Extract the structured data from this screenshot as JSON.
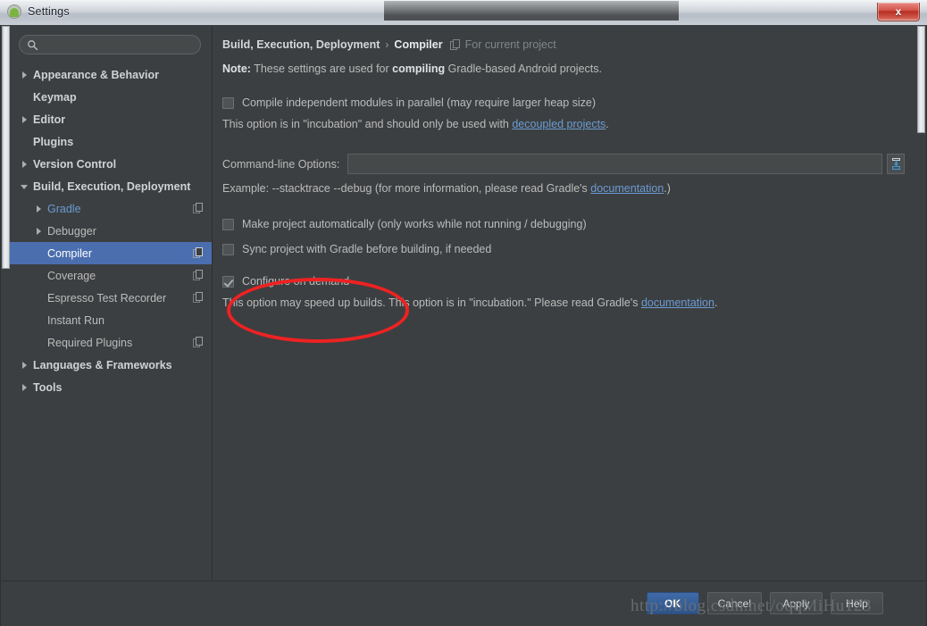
{
  "window": {
    "title": "Settings",
    "app_icon": "android-studio-icon",
    "close_label": "x"
  },
  "sidebar": {
    "search": {
      "placeholder": "",
      "value": "",
      "icon": "search-icon"
    },
    "items": [
      {
        "label": "Appearance & Behavior",
        "level": 0,
        "arrow": "right",
        "bold": true,
        "selected": false,
        "project_icon": false
      },
      {
        "label": "Keymap",
        "level": 0,
        "arrow": "none",
        "bold": true,
        "selected": false,
        "project_icon": false
      },
      {
        "label": "Editor",
        "level": 0,
        "arrow": "right",
        "bold": true,
        "selected": false,
        "project_icon": false
      },
      {
        "label": "Plugins",
        "level": 0,
        "arrow": "none",
        "bold": true,
        "selected": false,
        "project_icon": false
      },
      {
        "label": "Version Control",
        "level": 0,
        "arrow": "right",
        "bold": true,
        "selected": false,
        "project_icon": false
      },
      {
        "label": "Build, Execution, Deployment",
        "level": 0,
        "arrow": "down",
        "bold": true,
        "selected": false,
        "project_icon": false
      },
      {
        "label": "Gradle",
        "level": 1,
        "arrow": "right",
        "bold": false,
        "selected": false,
        "project_icon": true,
        "link": true
      },
      {
        "label": "Debugger",
        "level": 1,
        "arrow": "right",
        "bold": false,
        "selected": false,
        "project_icon": false
      },
      {
        "label": "Compiler",
        "level": 1,
        "arrow": "none",
        "bold": false,
        "selected": true,
        "project_icon": true
      },
      {
        "label": "Coverage",
        "level": 1,
        "arrow": "none",
        "bold": false,
        "selected": false,
        "project_icon": true
      },
      {
        "label": "Espresso Test Recorder",
        "level": 1,
        "arrow": "none",
        "bold": false,
        "selected": false,
        "project_icon": true
      },
      {
        "label": "Instant Run",
        "level": 1,
        "arrow": "none",
        "bold": false,
        "selected": false,
        "project_icon": false
      },
      {
        "label": "Required Plugins",
        "level": 1,
        "arrow": "none",
        "bold": false,
        "selected": false,
        "project_icon": true
      },
      {
        "label": "Languages & Frameworks",
        "level": 0,
        "arrow": "right",
        "bold": true,
        "selected": false,
        "project_icon": false
      },
      {
        "label": "Tools",
        "level": 0,
        "arrow": "right",
        "bold": true,
        "selected": false,
        "project_icon": false
      }
    ]
  },
  "main": {
    "breadcrumb": {
      "parent": "Build, Execution, Deployment",
      "separator": "›",
      "current": "Compiler",
      "scope_icon": "project-scope-icon",
      "scope": "For current project"
    },
    "note": {
      "prefix": "Note:",
      "text_before": " These settings are used for ",
      "emphasis": "compiling",
      "text_after": " Gradle-based Android projects."
    },
    "parallel": {
      "checkbox_label": "Compile independent modules in parallel (may require larger heap size)",
      "checked": false,
      "hint_before": "This option is in \"incubation\" and should only be used with ",
      "hint_link": "decoupled projects",
      "hint_after": "."
    },
    "command_line": {
      "label": "Command-line Options:",
      "value": "",
      "placeholder": "",
      "browse_icon": "insert-expand-icon",
      "example_before": "Example: --stacktrace --debug (for more information, please read Gradle's ",
      "example_link": "documentation",
      "example_after": ".)"
    },
    "make_auto": {
      "checkbox_label": "Make project automatically (only works while not running / debugging)",
      "checked": false
    },
    "sync_gradle": {
      "checkbox_label": "Sync project with Gradle before building, if needed",
      "checked": false
    },
    "configure_on_demand": {
      "checkbox_label": "Configure on demand",
      "checked": true,
      "hint_before": "This option may speed up builds. This option is in \"incubation.\" Please read Gradle's ",
      "hint_link": "documentation",
      "hint_after": "."
    },
    "annotation": {
      "shape": "ellipse",
      "color": "#ee2222"
    }
  },
  "footer": {
    "buttons": [
      {
        "label": "OK",
        "default": true
      },
      {
        "label": "Cancel",
        "default": false
      },
      {
        "label": "Apply",
        "default": false
      },
      {
        "label": "Help",
        "default": false
      }
    ],
    "watermark": "http://blog.csdn.net/oqqMiHu123"
  },
  "colors": {
    "accent_selection": "#4b6eaf",
    "link": "#6b9bd2",
    "panel_bg": "#3c3f41",
    "annotation_red": "#ee2222",
    "close_red": "#b92f25"
  }
}
